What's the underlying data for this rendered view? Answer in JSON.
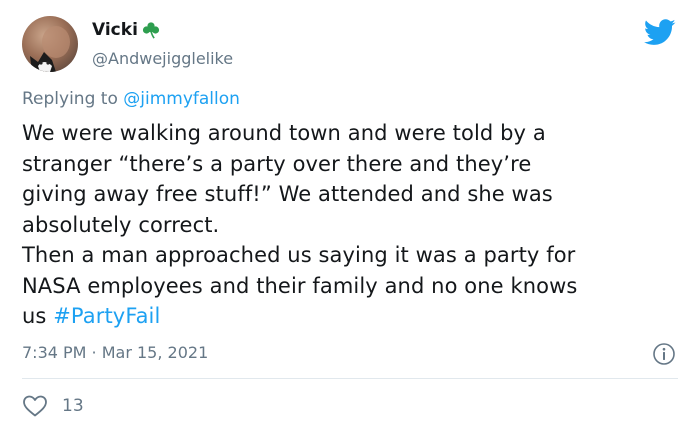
{
  "user": {
    "display_name": "Vicki",
    "handle": "@Andwejigglelike"
  },
  "reply": {
    "prefix": "Replying to ",
    "mention": "@jimmyfallon"
  },
  "tweet": {
    "text": "We were walking around town and were told by a\nstranger “there’s a party over there and they’re\ngiving away free stuff!” We attended and she was\nabsolutely correct.\nThen a man approached us saying it was a party for\nNASA employees and their family and no one knows\nus ",
    "hashtag": "#PartyFail"
  },
  "meta": {
    "timestamp": "7:34 PM · Mar 15, 2021"
  },
  "engagement": {
    "likes": "13"
  },
  "colors": {
    "accent": "#1da1f2",
    "secondary_text": "#657786",
    "clover": "#2e9e4f"
  }
}
